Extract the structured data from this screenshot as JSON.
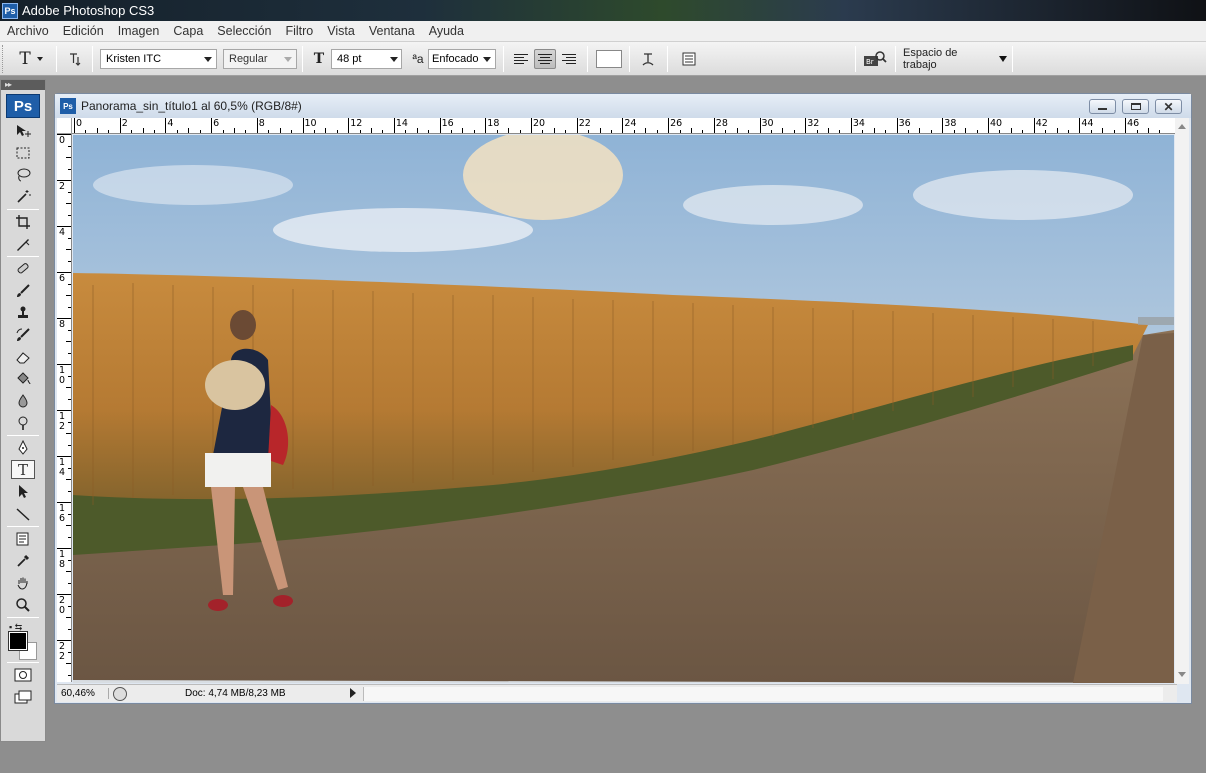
{
  "window": {
    "title": "Adobe Photoshop CS3",
    "icon": "ps-icon"
  },
  "menu": [
    "Archivo",
    "Edición",
    "Imagen",
    "Capa",
    "Selección",
    "Filtro",
    "Vista",
    "Ventana",
    "Ayuda"
  ],
  "options": {
    "tool_glyph": "T",
    "font_family": "Kristen ITC",
    "font_style": "Regular",
    "font_size": "48 pt",
    "aa_glyph": "ªa",
    "antialias": "Enfocado",
    "workspace": "Espacio de trabajo"
  },
  "tools": {
    "ps_logo": "Ps",
    "items": [
      "move-icon",
      "marquee-icon",
      "lasso-icon",
      "magic-wand-icon",
      "crop-icon",
      "slice-icon",
      "healing-brush-icon",
      "brush-icon",
      "clone-stamp-icon",
      "history-brush-icon",
      "eraser-icon",
      "paint-bucket-icon",
      "blur-icon",
      "dodge-icon",
      "pen-icon",
      "type-icon",
      "path-selection-icon",
      "line-icon",
      "notes-icon",
      "eyedropper-icon",
      "hand-icon",
      "zoom-icon"
    ],
    "active": "type-icon",
    "foreground_color": "#000000",
    "background_color": "#ffffff"
  },
  "document": {
    "title": "Panorama_sin_título1 al 60,5% (RGB/8#)",
    "ruler_h": [
      "0",
      "2",
      "4",
      "6",
      "8",
      "10",
      "12",
      "14",
      "16",
      "18",
      "20",
      "22",
      "24",
      "26",
      "28",
      "30",
      "32",
      "34",
      "36",
      "38",
      "40",
      "42",
      "44",
      "46"
    ],
    "ruler_v": [
      "0",
      "2",
      "4",
      "6",
      "8",
      "1 0",
      "1 2",
      "1 4",
      "1 6",
      "1 8",
      "2 0",
      "2 2"
    ]
  },
  "status": {
    "zoom": "60,46%",
    "doc_size": "Doc: 4,74 MB/8,23 MB"
  }
}
